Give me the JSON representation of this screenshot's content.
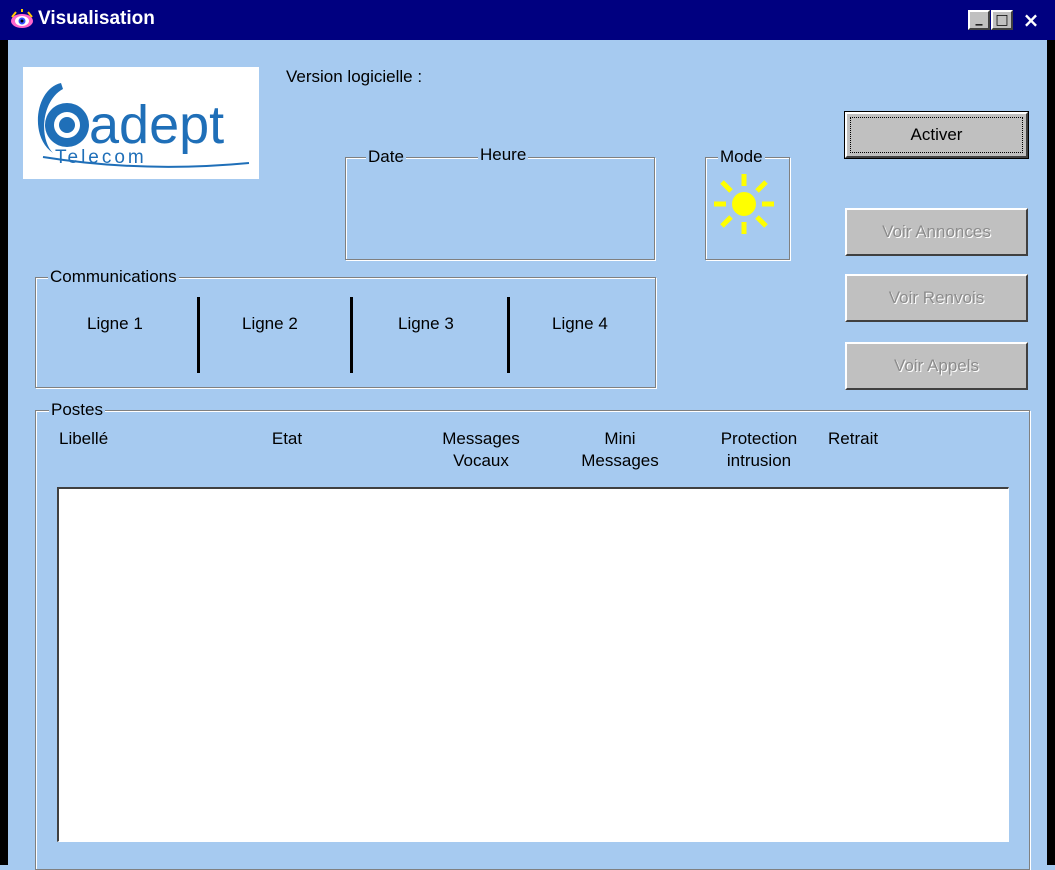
{
  "window": {
    "title": "Visualisation",
    "icon": "app-eye-icon",
    "controls": {
      "minimize": "_",
      "maximize": "□",
      "close": "×"
    }
  },
  "logo": {
    "brand": "adept",
    "sub": "Telecom"
  },
  "version": {
    "label": "Version logicielle :"
  },
  "datetime": {
    "date_label": "Date",
    "time_label": "Heure"
  },
  "mode": {
    "label": "Mode",
    "icon": "sun-icon",
    "color": "#ffff00"
  },
  "buttons": {
    "activer": "Activer",
    "voir_annonces": "Voir Annonces",
    "voir_renvois": "Voir Renvois",
    "voir_appels": "Voir Appels"
  },
  "communications": {
    "label": "Communications",
    "lines": [
      "Ligne 1",
      "Ligne 2",
      "Ligne 3",
      "Ligne 4"
    ]
  },
  "postes": {
    "label": "Postes",
    "columns": [
      {
        "line1": "Libellé",
        "line2": ""
      },
      {
        "line1": "Etat",
        "line2": ""
      },
      {
        "line1": "Messages",
        "line2": "Vocaux"
      },
      {
        "line1": "Mini",
        "line2": "Messages"
      },
      {
        "line1": "Protection",
        "line2": "intrusion"
      },
      {
        "line1": "Retrait",
        "line2": ""
      }
    ],
    "rows": []
  },
  "colors": {
    "background": "#a6caf0",
    "titlebar": "#000080",
    "button_face": "#c0c0c0",
    "logo_blue": "#1f6fb8"
  }
}
